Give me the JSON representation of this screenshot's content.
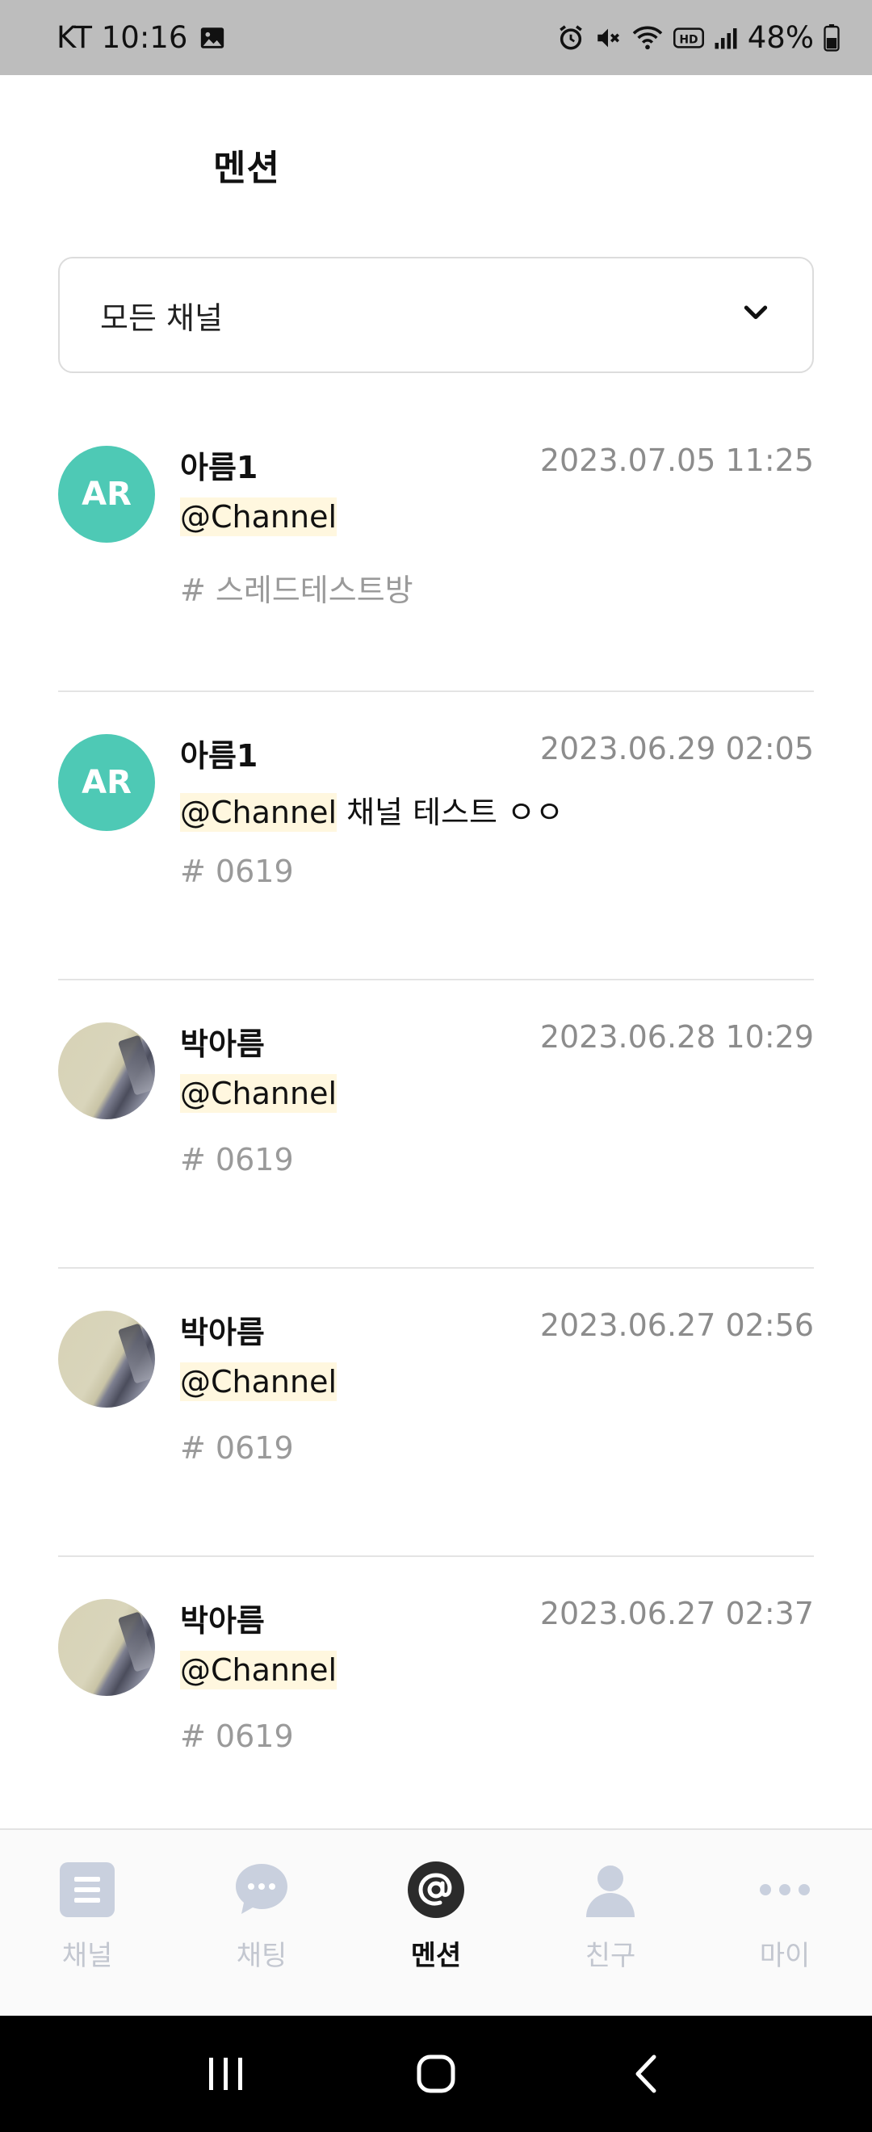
{
  "status_bar": {
    "carrier_time": "KT 10:16",
    "battery": "48%",
    "icons": [
      "image-icon",
      "alarm-icon",
      "mute-icon",
      "wifi-icon",
      "hd-icon",
      "signal-icon",
      "battery-icon"
    ]
  },
  "header": {
    "title": "멘션"
  },
  "filter": {
    "selected": "모든 채널",
    "icon": "chevron-down-icon"
  },
  "mentions": [
    {
      "avatar_type": "initials",
      "avatar_text": "AR",
      "name": "아름1",
      "time": "2023.07.05 11:25",
      "mention": "@Channel",
      "message": "",
      "channel": "# 스레드테스트방"
    },
    {
      "avatar_type": "initials",
      "avatar_text": "AR",
      "name": "아름1",
      "time": "2023.06.29 02:05",
      "mention": "@Channel",
      "message": " 채널 테스트 ㅇㅇ",
      "channel": "# 0619"
    },
    {
      "avatar_type": "photo",
      "avatar_text": "",
      "name": "박아름",
      "time": "2023.06.28 10:29",
      "mention": "@Channel",
      "message": "",
      "channel": "# 0619"
    },
    {
      "avatar_type": "photo",
      "avatar_text": "",
      "name": "박아름",
      "time": "2023.06.27 02:56",
      "mention": "@Channel",
      "message": "",
      "channel": "# 0619"
    },
    {
      "avatar_type": "photo",
      "avatar_text": "",
      "name": "박아름",
      "time": "2023.06.27 02:37",
      "mention": "@Channel",
      "message": "",
      "channel": "# 0619"
    }
  ],
  "bottom_nav": [
    {
      "label": "채널",
      "icon": "channel-list-icon",
      "active": false
    },
    {
      "label": "채팅",
      "icon": "chat-bubble-icon",
      "active": false
    },
    {
      "label": "멘션",
      "icon": "at-sign-icon",
      "active": true
    },
    {
      "label": "친구",
      "icon": "person-icon",
      "active": false
    },
    {
      "label": "마이",
      "icon": "more-dots-icon",
      "active": false
    }
  ],
  "colors": {
    "avatar_teal": "#4ec9b5",
    "mention_highlight": "#fff7df",
    "nav_inactive": "#c3c7d0",
    "status_bar_bg": "#bdbdbd"
  }
}
